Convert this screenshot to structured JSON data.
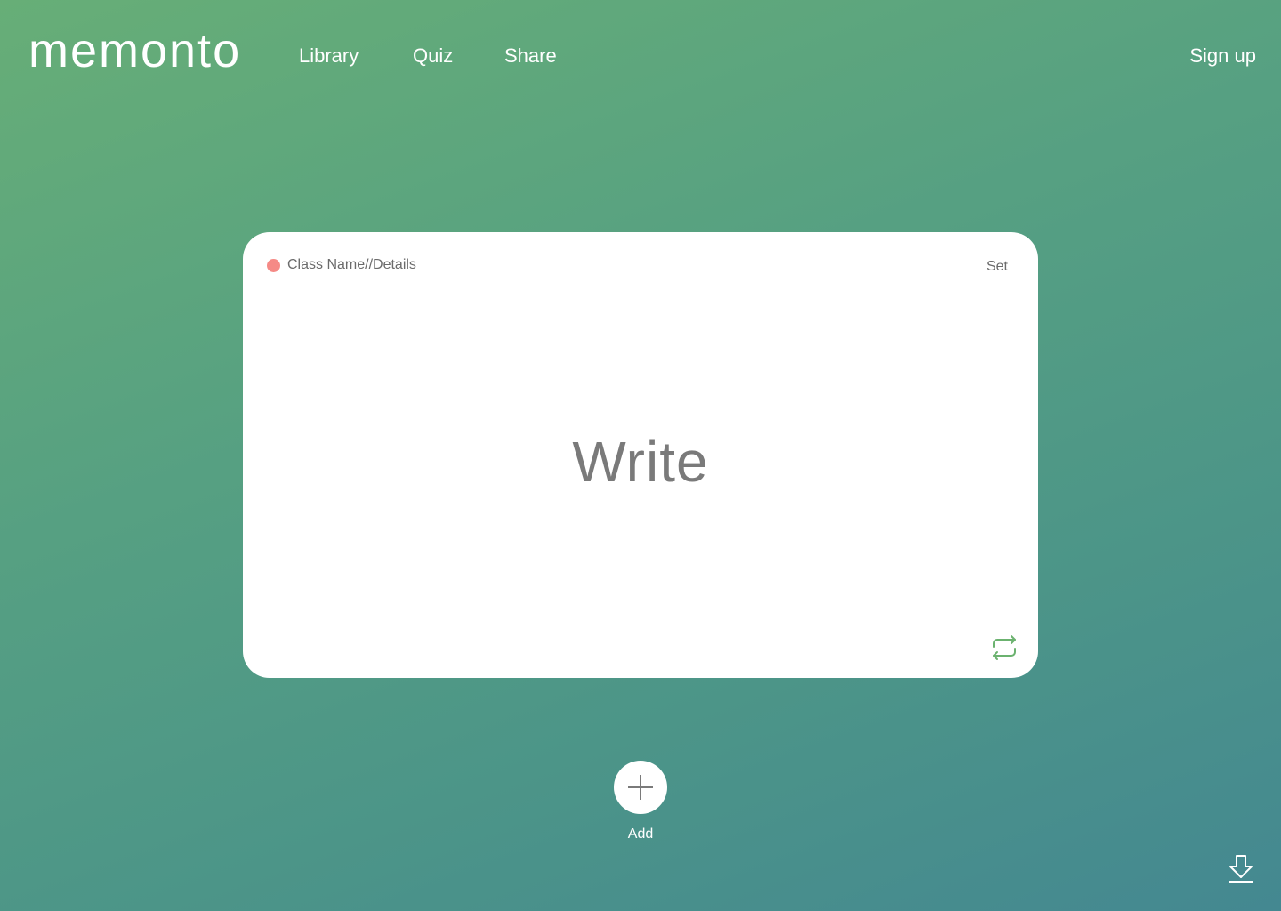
{
  "app": {
    "logo": "memonto"
  },
  "nav": {
    "items": [
      {
        "label": "Library"
      },
      {
        "label": "Quiz"
      },
      {
        "label": "Share"
      }
    ],
    "signup_label": "Sign up"
  },
  "card": {
    "class_name": "Class Name//Details",
    "set_label": "Set",
    "content": "Write",
    "status_color": "#f58a86",
    "flip_icon": "repeat-icon"
  },
  "actions": {
    "add_label": "Add",
    "add_icon": "plus-icon",
    "download_icon": "download-icon"
  },
  "colors": {
    "gradient_start": "#67ae77",
    "gradient_end": "#448891",
    "accent_green": "#6bb26f"
  }
}
